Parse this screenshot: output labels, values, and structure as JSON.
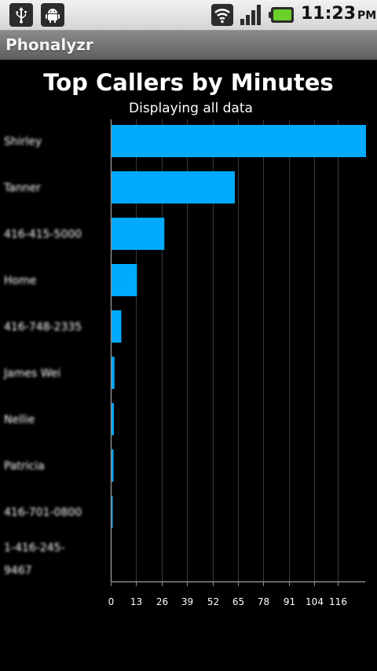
{
  "status_bar": {
    "time": "11:23",
    "ampm": "PM",
    "icons": [
      "usb-icon",
      "android-debug-icon",
      "wifi-icon",
      "signal-icon",
      "battery-icon"
    ],
    "battery_color": "#6ad12a"
  },
  "app": {
    "title": "Phonalyzr"
  },
  "chart_data": {
    "type": "bar",
    "orientation": "horizontal",
    "title": "Top Callers by Minutes",
    "subtitle": "Displaying all data",
    "categories": [
      "Shirley",
      "Tanner",
      "416-415-5000",
      "Home",
      "416-748-2335",
      "James Wei",
      "Nellie",
      "Patricia",
      "416-701-0800",
      "1-416-245-9467"
    ],
    "values": [
      130,
      63,
      27,
      13,
      5,
      1.5,
      1.2,
      1.0,
      0.6,
      0
    ],
    "xticks": [
      0,
      13,
      26,
      39,
      52,
      65,
      78,
      91,
      104,
      116
    ],
    "xlim": [
      0,
      130
    ],
    "grid": true,
    "bar_color": "#00aaff",
    "grid_color": "#3a3a3a",
    "axis_color": "#8c8c8c",
    "labels_blurred": true
  }
}
